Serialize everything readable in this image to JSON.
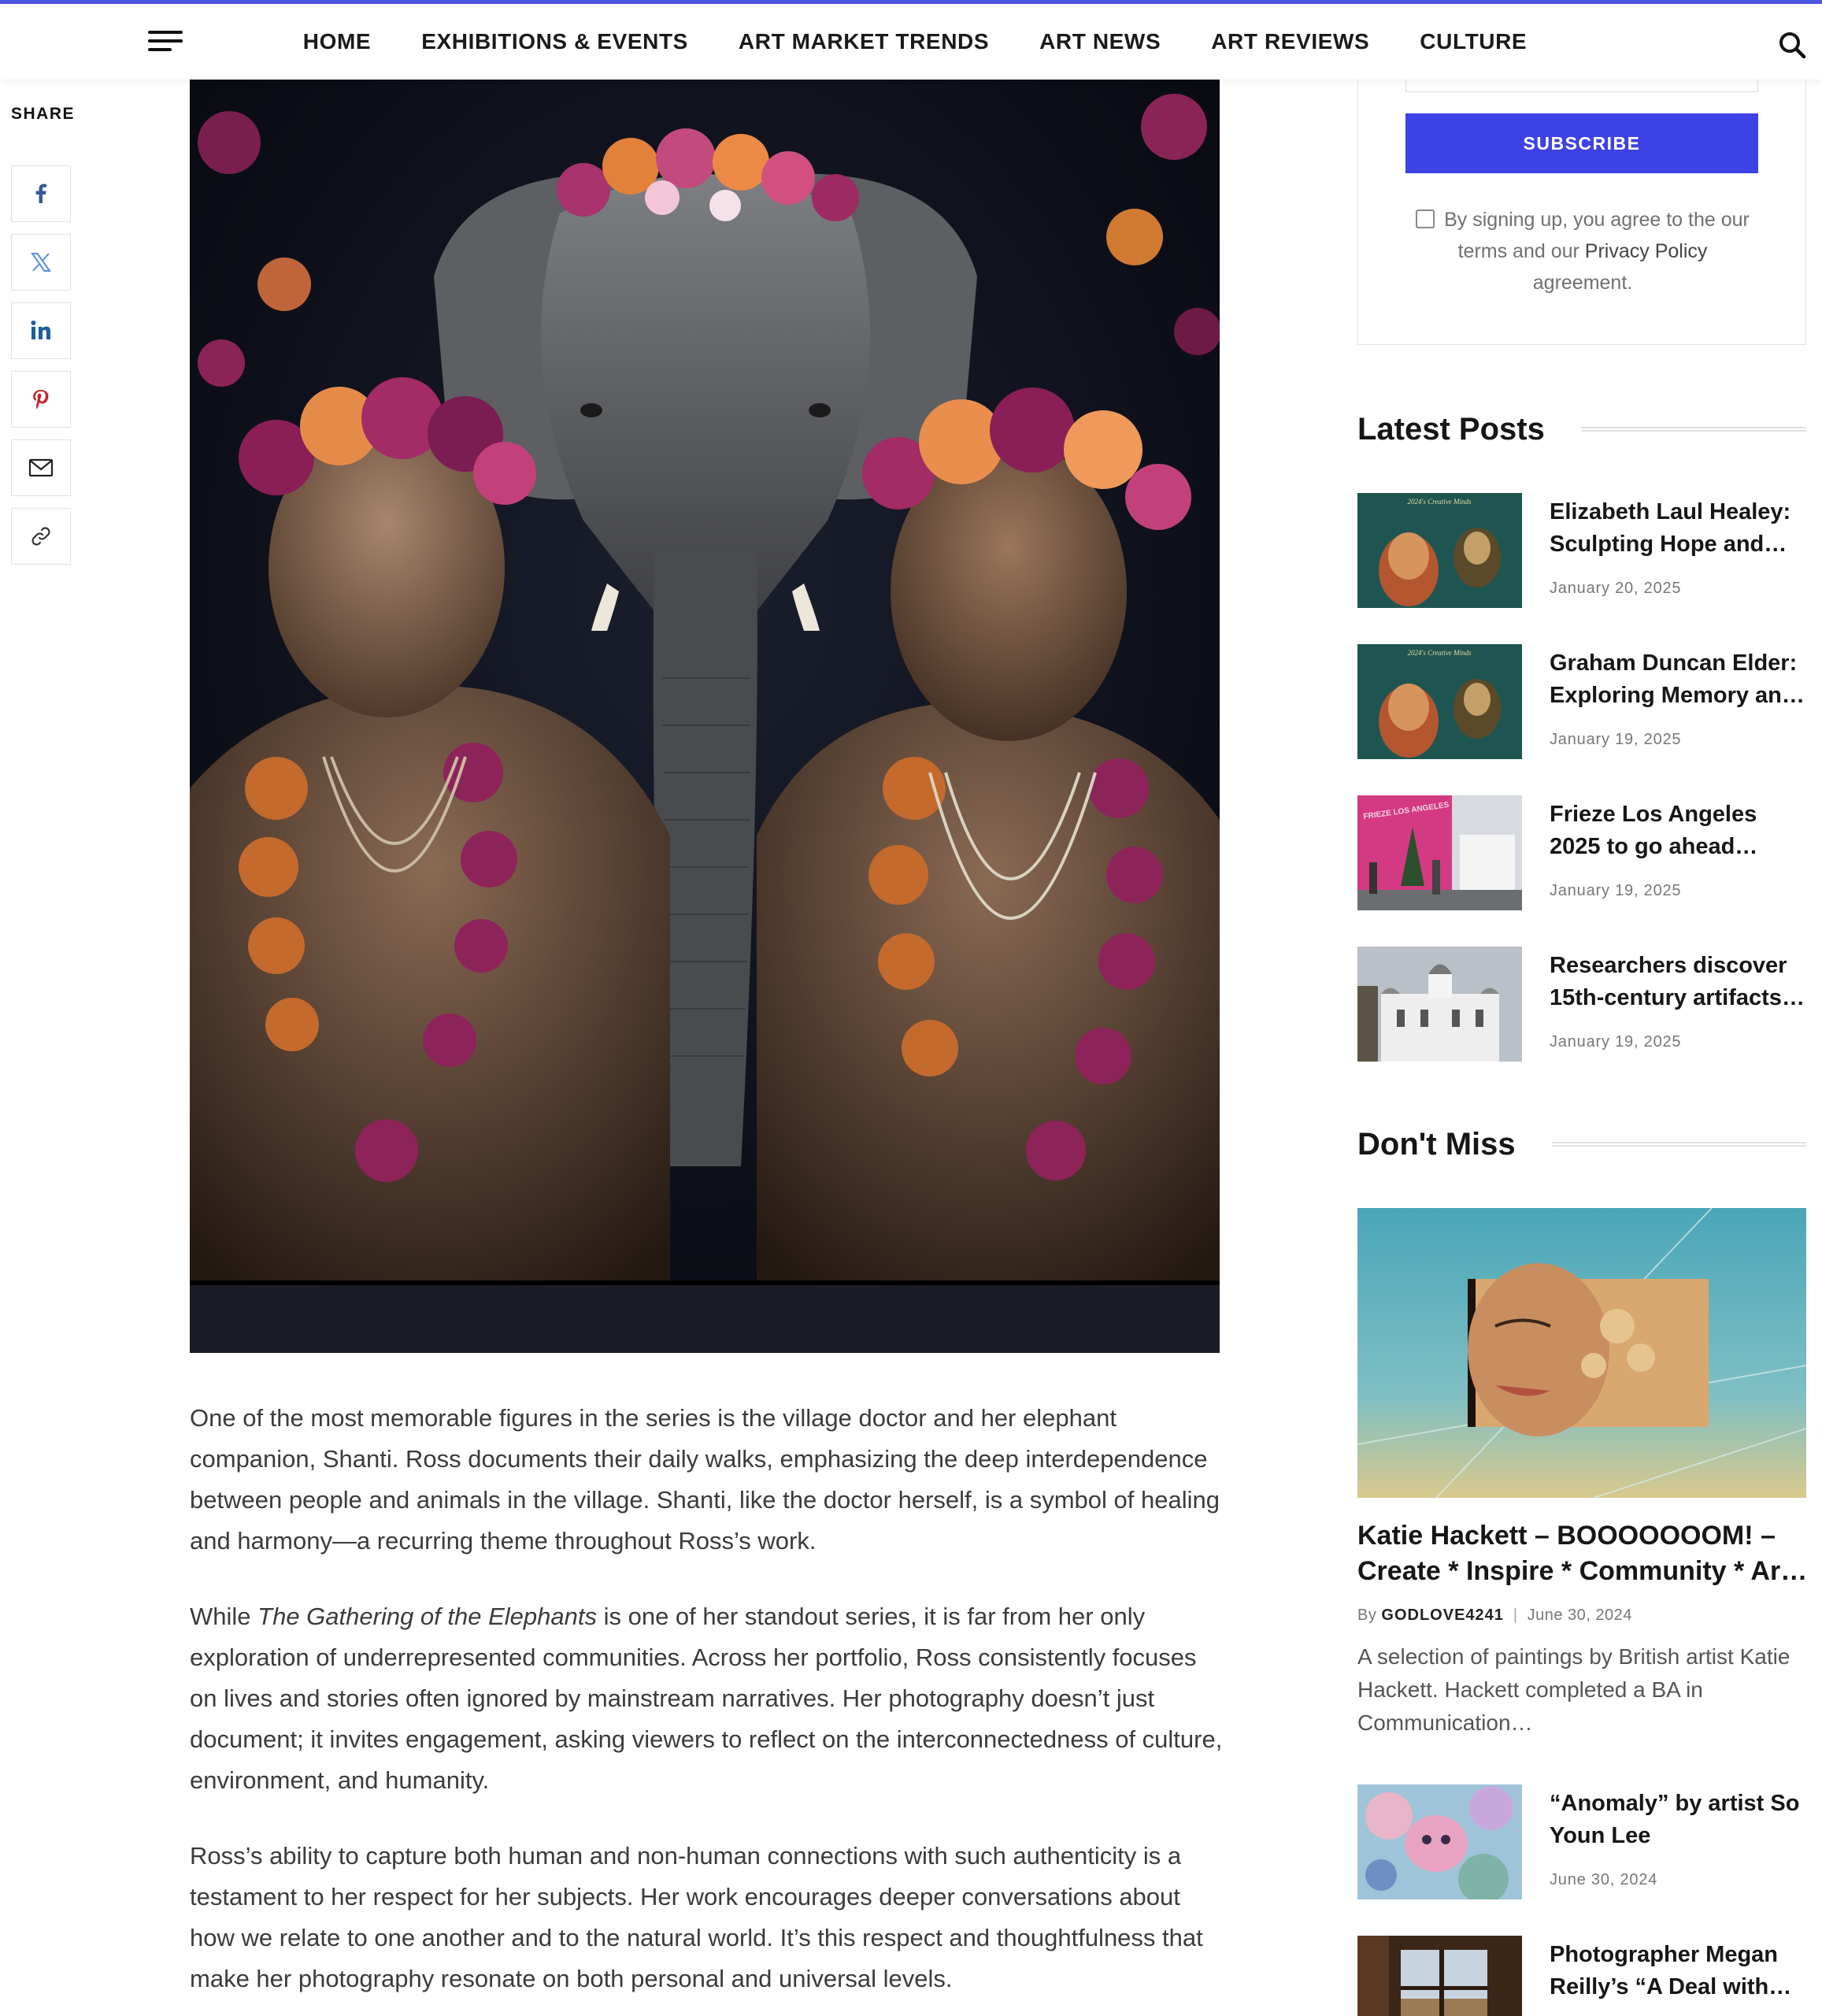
{
  "nav": {
    "items": [
      "HOME",
      "EXHIBITIONS & EVENTS",
      "ART MARKET TRENDS",
      "ART NEWS",
      "ART REVIEWS",
      "CULTURE"
    ],
    "accent_color": "#4a55e0"
  },
  "share": {
    "label": "SHARE",
    "buttons": [
      "facebook-icon",
      "x-icon",
      "linkedin-icon",
      "pinterest-icon",
      "email-icon",
      "link-icon"
    ]
  },
  "article": {
    "paragraphs": [
      "One of the most memorable figures in the series is the village doctor and her elephant companion, Shanti. Ross documents their daily walks, emphasizing the deep interdependence between people and animals in the village. Shanti, like the doctor herself, is a symbol of healing and harmony—a recurring theme throughout Ross’s work.",
      {
        "lead": "While ",
        "italic": "The Gathering of the Elephants",
        "rest": " is one of her standout series, it is far from her only exploration of underrepresented communities. Across her portfolio, Ross consistently focuses on lives and stories often ignored by mainstream narratives. Her photography doesn’t just document; it invites engagement, asking viewers to reflect on the interconnectedness of culture, environment, and humanity."
      },
      "Ross’s ability to capture both human and non-human connections with such authenticity is a testament to her respect for her subjects. Her work encourages deeper conversations about how we relate to one another and to the natural world. It’s this respect and thoughtfulness that make her photography resonate on both personal and universal levels."
    ]
  },
  "newsletter": {
    "subscribe_label": "SUBSCRIBE",
    "subscribe_color": "#3d42e6",
    "agree_text_before": "By signing up, you agree to the our terms and our ",
    "privacy_link": "Privacy Policy",
    "agree_text_after": " agreement."
  },
  "latest_posts": {
    "heading": "Latest Posts",
    "items": [
      {
        "title": "Elizabeth Laul Healey: Sculpting Hope and…",
        "date": "January 20, 2025",
        "thumb_caption": "2024's Creative Minds"
      },
      {
        "title": "Graham Duncan Elder: Exploring Memory an…",
        "date": "January 19, 2025",
        "thumb_caption": "2024's Creative Minds"
      },
      {
        "title": "Frieze Los Angeles 2025 to go ahead…",
        "date": "January 19, 2025",
        "thumb_caption": "FRIEZE LOS ANGELES"
      },
      {
        "title": "Researchers discover 15th-century artifacts …",
        "date": "January 19, 2025"
      }
    ]
  },
  "dont_miss": {
    "heading": "Don't Miss",
    "feature": {
      "title": "Katie Hackett – BOOOOOOOM! – Create * Inspire * Community * Art …",
      "by": "By",
      "author": "GODLOVE4241",
      "date": "June 30, 2024",
      "excerpt": "A selection of paintings by British artist Katie Hackett. Hackett completed a BA in Communication…"
    },
    "items": [
      {
        "title": "“Anomaly” by artist So Youn Lee",
        "date": "June 30, 2024"
      },
      {
        "title": "Photographer Megan Reilly’s “A Deal with…"
      }
    ]
  }
}
